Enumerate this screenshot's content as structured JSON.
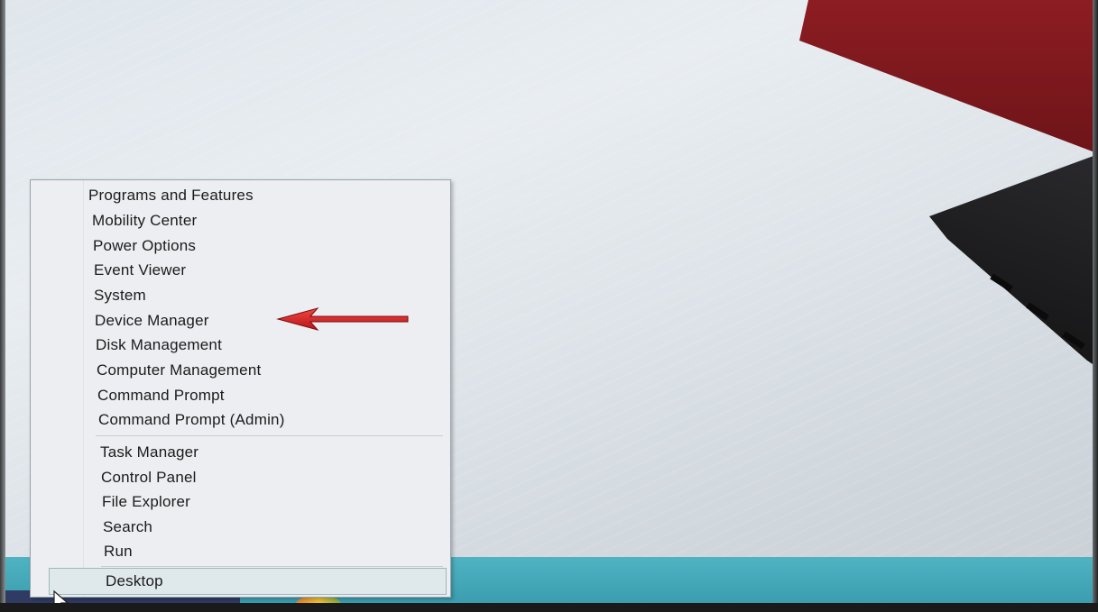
{
  "context_menu": {
    "group1": [
      "Programs and Features",
      "Mobility Center",
      "Power Options",
      "Event Viewer",
      "System",
      "Device Manager",
      "Disk Management",
      "Computer Management",
      "Command Prompt",
      "Command Prompt (Admin)"
    ],
    "group2": [
      "Task Manager",
      "Control Panel",
      "File Explorer",
      "Search",
      "Run"
    ],
    "desktop": "Desktop"
  },
  "annotation": {
    "icon": "red-arrow-icon",
    "color": "#d7262a"
  },
  "colors": {
    "menu_background": "#eceef1",
    "taskbar": "#4fb3c2",
    "highlight": "#dfe8ea"
  }
}
